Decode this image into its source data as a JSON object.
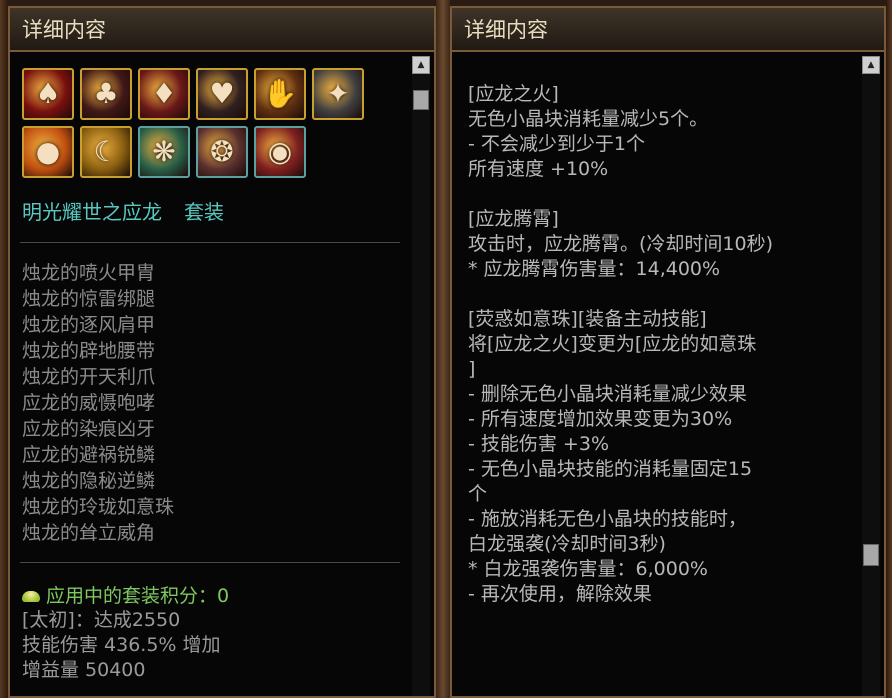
{
  "left_panel": {
    "title": "详细内容",
    "icon_rows": [
      [
        {
          "icon": "red-dragon-helmet-icon",
          "glyph": "♠",
          "bg": "#7a1010",
          "frame": "#c8a030"
        },
        {
          "icon": "dark-dragon-leggings-icon",
          "glyph": "♣",
          "bg": "#401818",
          "frame": "#c8a030"
        },
        {
          "icon": "dragon-shoulder-icon",
          "glyph": "♦",
          "bg": "#6a1818",
          "frame": "#c8a030"
        },
        {
          "icon": "dragon-belt-icon",
          "glyph": "♥",
          "bg": "#302020",
          "frame": "#c8a030"
        },
        {
          "icon": "dragon-claw-icon",
          "glyph": "✋",
          "bg": "#603010",
          "frame": "#c8a030"
        },
        {
          "icon": "dragon-roar-icon",
          "glyph": "✦",
          "bg": "#404040",
          "frame": "#c8a030"
        }
      ],
      [
        {
          "icon": "pearl-orb-icon",
          "glyph": "●",
          "bg": "#c05010",
          "frame": "#c8a030"
        },
        {
          "icon": "dragon-fang-icon",
          "glyph": "☾",
          "bg": "#8a6010",
          "frame": "#c8a030"
        },
        {
          "icon": "dragon-scale-icon",
          "glyph": "❋",
          "bg": "#2a6048",
          "frame": "#5ca0a0"
        },
        {
          "icon": "reverse-scale-icon",
          "glyph": "❂",
          "bg": "#5a3030",
          "frame": "#5ca0a0"
        },
        {
          "icon": "red-orb-icon",
          "glyph": "◉",
          "bg": "#802020",
          "frame": "#5ca0a0"
        }
      ]
    ],
    "set_name": "明光耀世之应龙",
    "set_suffix": "套装",
    "parts": [
      "烛龙的喷火甲胄",
      "烛龙的惊雷绑腿",
      "烛龙的逐风肩甲",
      "烛龙的辟地腰带",
      "烛龙的开天利爪",
      "应龙的威慑咆哮",
      "应龙的染痕凶牙",
      "应龙的避祸锐鳞",
      "烛龙的隐秘逆鳞",
      "烛龙的玲珑如意珠",
      "烛龙的耸立威角"
    ],
    "bonus": {
      "score": "应用中的套装积分：0",
      "tier": "[太初]：达成2550",
      "skill_damage": "技能伤害 436.5% 增加",
      "buff": "增益量 50400"
    }
  },
  "right_panel": {
    "title": "详细内容",
    "sections": [
      {
        "lines": [
          "[应龙之火]",
          "无色小晶块消耗量减少5个。",
          "- 不会减少到少于1个",
          "所有速度 +10%"
        ]
      },
      {
        "lines": [
          "[应龙腾霄]",
          "攻击时，应龙腾霄。(冷却时间10秒)",
          "* 应龙腾霄伤害量：14,400%"
        ]
      },
      {
        "lines": [
          "[荧惑如意珠][装备主动技能]",
          "将[应龙之火]变更为[应龙的如意珠",
          "]",
          "- 删除无色小晶块消耗量减少效果",
          "- 所有速度增加效果变更为30%",
          "- 技能伤害 +3%",
          "- 无色小晶块技能的消耗量固定15",
          "个",
          "- 施放消耗无色小晶块的技能时，",
          "白龙强袭(冷却时间3秒)",
          "* 白龙强袭伤害量：6,000%",
          "- 再次使用，解除效果"
        ]
      }
    ]
  },
  "scrollbar": {
    "up_glyph": "▲"
  }
}
